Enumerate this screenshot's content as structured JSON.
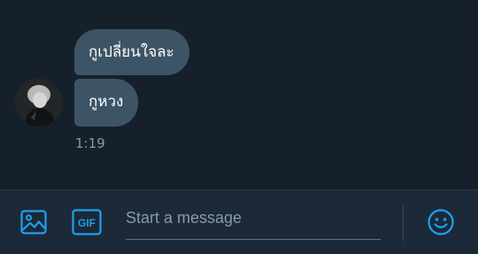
{
  "conversation": {
    "messages": [
      {
        "text": "กูเปลี่ยนใจละ"
      },
      {
        "text": "กูหวง"
      }
    ],
    "timestamp": "1:19"
  },
  "composer": {
    "placeholder": "Start a message",
    "gif_label": "GIF",
    "icons": {
      "media": "image-icon",
      "gif": "gif-icon",
      "emoji": "emoji-icon"
    }
  },
  "colors": {
    "background": "#15202b",
    "bubble": "#3d5466",
    "composer": "#1c2938",
    "accent": "#1da1f2",
    "muted_text": "#8899a6"
  }
}
